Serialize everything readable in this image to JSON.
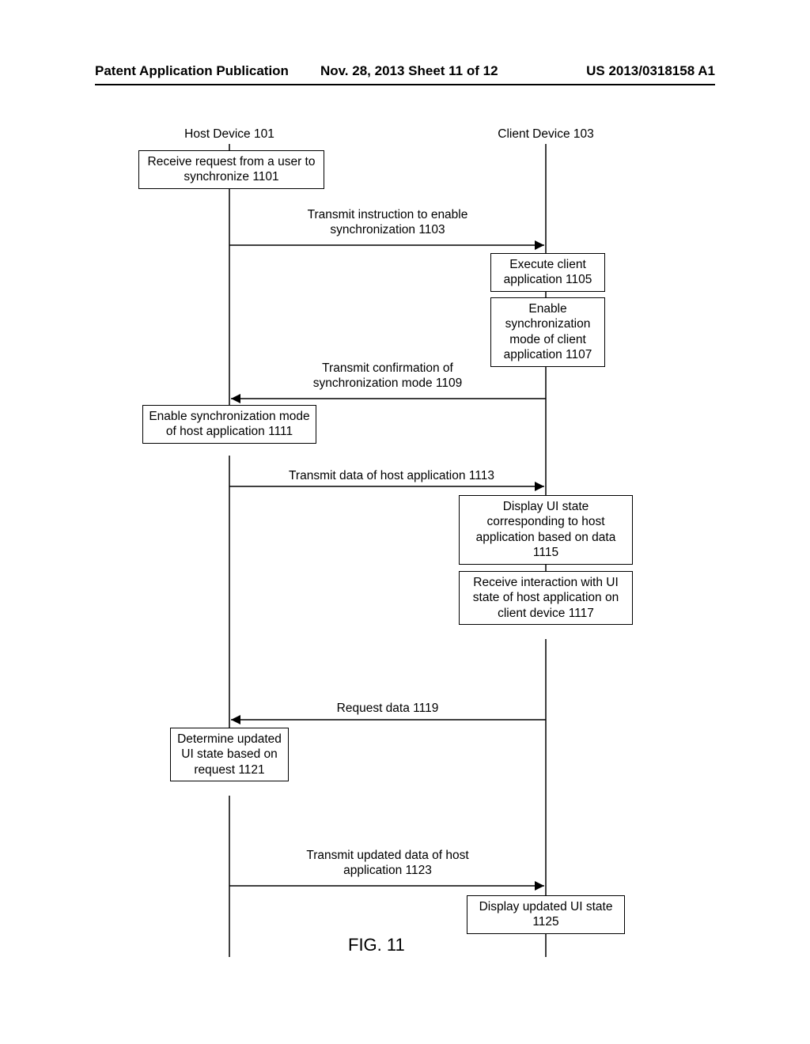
{
  "header": {
    "left": "Patent Application Publication",
    "mid": "Nov. 28, 2013  Sheet 11 of 12",
    "right": "US 2013/0318158 A1"
  },
  "lanes": {
    "host": "Host Device 101",
    "client": "Client Device 103"
  },
  "boxes": {
    "b1101": "Receive request from a user to\nsynchronize 1101",
    "b1105": "Execute client\napplication 1105",
    "b1107": "Enable\nsynchronization\nmode of client\napplication 1107",
    "b1111": "Enable synchronization\nmode of host application\n1111",
    "b1115": "Display UI state\ncorresponding to host\napplication based on data\n1115",
    "b1117": "Receive interaction with\nUI state of host\napplication on client\ndevice 1117",
    "b1121": "Determine\nupdated UI state\nbased on request\n1121",
    "b1125": "Display updated UI state\n1125"
  },
  "messages": {
    "m1103": "Transmit instruction to enable\nsynchronization 1103",
    "m1109": "Transmit confirmation of\nsynchronization mode 1109",
    "m1113": "Transmit data of host application 1113",
    "m1119": "Request data 1119",
    "m1123": "Transmit updated data of host\napplication 1123"
  },
  "figure": "FIG. 11"
}
